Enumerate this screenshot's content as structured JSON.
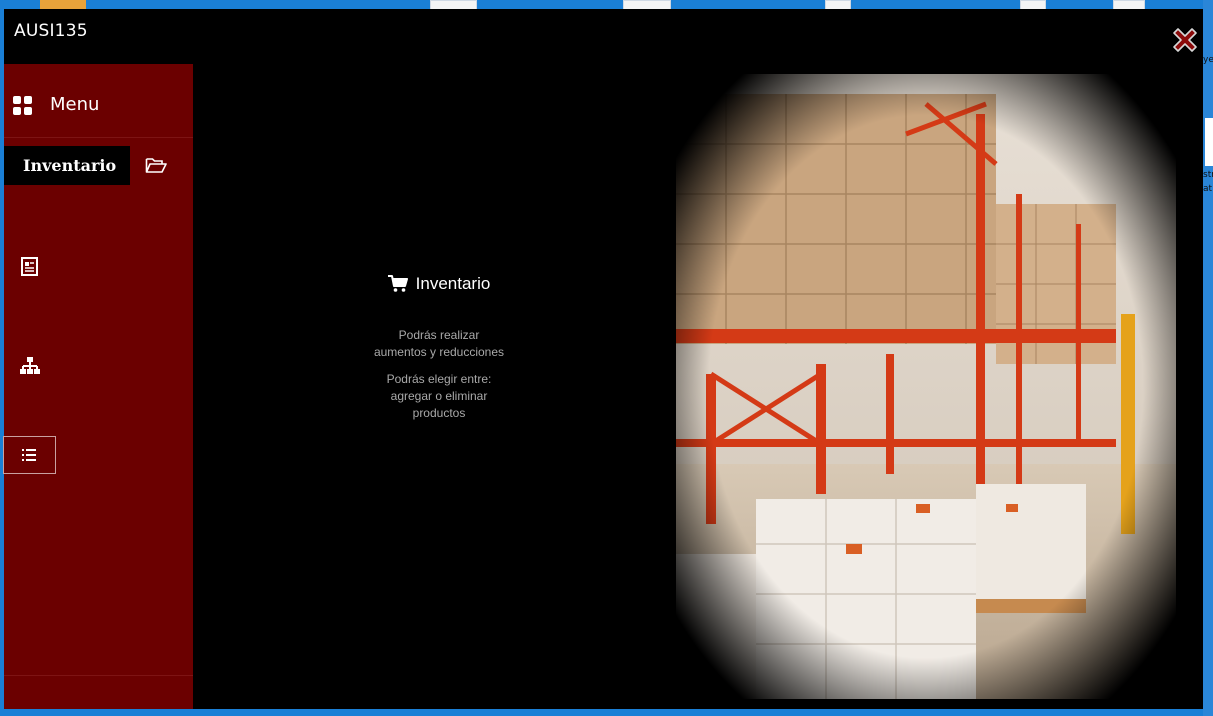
{
  "window": {
    "title": "AUSI135",
    "close_icon": "close-icon"
  },
  "sidebar": {
    "menu_label": "Menu",
    "menu_icon": "grid-icon",
    "active_item_label": "Inventario",
    "items": [
      {
        "icon": "folder-open-icon"
      },
      {
        "icon": "document-icon"
      },
      {
        "icon": "sitemap-icon"
      },
      {
        "icon": "list-icon"
      }
    ]
  },
  "info": {
    "title": "Inventario",
    "icon": "cart-icon",
    "line1": "Podrás realizar",
    "line2": "aumentos y reducciones",
    "line3": "Podrás elegir entre:",
    "line4": "agregar o eliminar",
    "line5": "productos"
  },
  "desktop_right": {
    "t1": "ye",
    "t2": "str",
    "t3": "at"
  },
  "colors": {
    "sidebar": "#6b0000",
    "background": "#000000",
    "desktop": "#1a7fd6",
    "close": "#8b0a0a"
  }
}
